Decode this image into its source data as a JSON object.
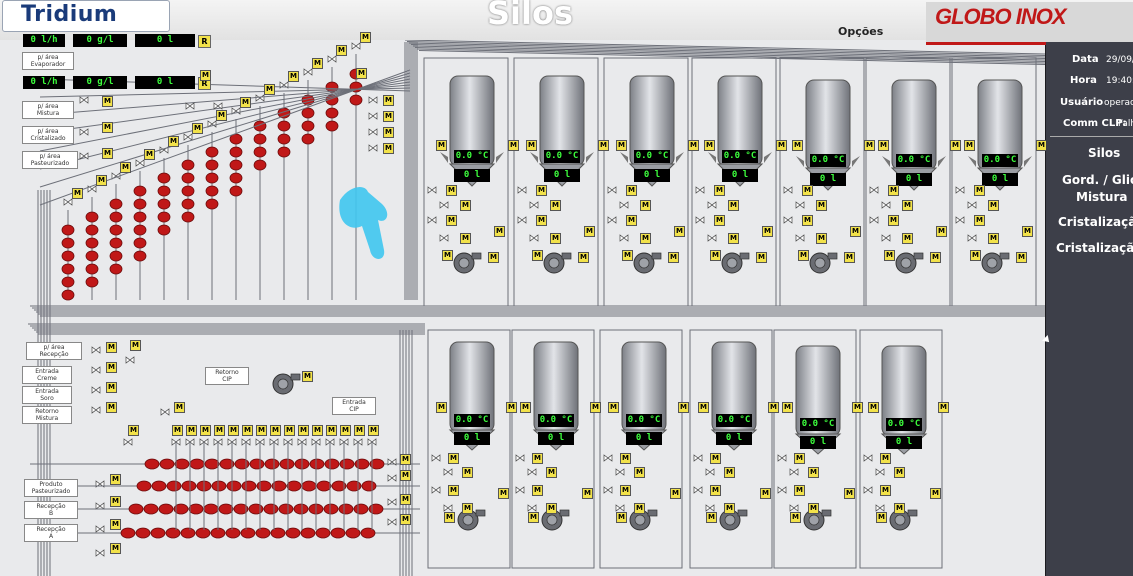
{
  "header": {
    "brand_left": "Tridium",
    "title": "Silos",
    "options_label": "Opções",
    "brand_right": "GLOBO INOX"
  },
  "top_readouts": [
    {
      "flow": "0 l/h",
      "conc": "0 g/l",
      "total": "0 l",
      "reset": "R"
    },
    {
      "flow": "0 l/h",
      "conc": "0 g/l",
      "total": "0 l",
      "reset": "R"
    }
  ],
  "upper_labels": {
    "evaporador": "p/ área\nEvaporador",
    "mistura": "p/ área\nMistura",
    "cristalizado": "p/ área\nCristalizado",
    "pasteurizado": "p/ área\nPasteurizado"
  },
  "lower_labels": {
    "recepcao": "p/ área\nRecepção",
    "creme": "Entrada\nCreme",
    "soro": "Entrada\nSoro",
    "retorno_mistura": "Retorno\nMistura",
    "retorno_cip": "Retorno\nCIP",
    "entrada_cip": "Entrada\nCIP",
    "produto_pasteurizado": "Produto\nPasteurizado",
    "recepcao_b": "Recepção\nB",
    "recepcao_a": "Recepção\nA"
  },
  "silo_temp": "0.0 °C",
  "silo_level": "0 l",
  "motor_label": "M",
  "side_panel": {
    "data_label": "Data",
    "data_value": "29/09/",
    "hora_label": "Hora",
    "hora_value": "19:40:",
    "usuario_label": "Usuário",
    "usuario_value": "operac",
    "comm_label": "Comm CLP:",
    "comm_value": "Falh",
    "menu": [
      "Silos",
      "Gord. / Glic",
      "Mistura",
      "Cristalizaçã",
      "Cristalizaçã"
    ]
  },
  "colors": {
    "accent_red": "#c01818",
    "display_green": "#3dff3d",
    "panel_bg": "#3d3f49",
    "label_yellow": "#f2e24a"
  }
}
